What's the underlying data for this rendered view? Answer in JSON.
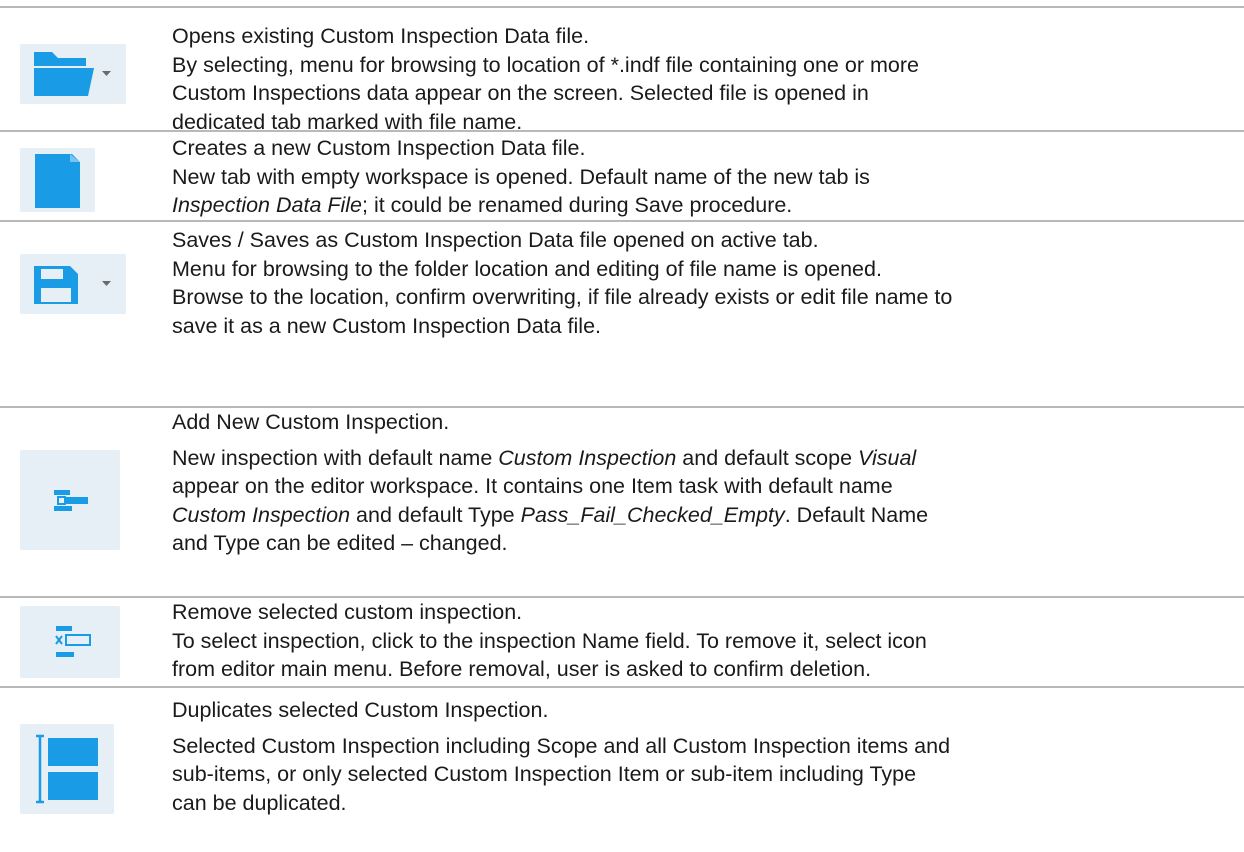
{
  "colors": {
    "icon_blue": "#1a9be6",
    "tile_bg": "#e6eef6",
    "rule": "#b9b9b9"
  },
  "rows": [
    {
      "icon": "folder-open-icon",
      "has_dropdown": true,
      "title": "Opens existing Custom Inspection Data file.",
      "lines": [
        "By selecting, menu for browsing to location of *.indf file containing one or more",
        "Custom Inspections data appear on the screen. Selected file is opened in",
        "dedicated tab marked with file name."
      ]
    },
    {
      "icon": "new-file-icon",
      "has_dropdown": false,
      "title": "Creates a new Custom Inspection Data file.",
      "line1": "New tab with empty workspace is opened. Default name of the new tab is",
      "line2_italic": "Inspection Data File",
      "line2_rest": "; it could be renamed during Save procedure."
    },
    {
      "icon": "save-icon",
      "has_dropdown": true,
      "title": "Saves / Saves as Custom Inspection Data file opened on active tab.",
      "lines": [
        "Menu for browsing to the folder location and editing of file name is opened.",
        "Browse to the location, confirm overwriting, if file already exists or edit file name to",
        "save it as a new Custom Inspection Data file."
      ]
    },
    {
      "icon": "add-inspection-icon",
      "has_dropdown": false,
      "title": "Add New Custom Inspection.",
      "l1a": "New inspection with default name ",
      "l1b": "Custom Inspection",
      "l1c": " and default scope ",
      "l1d": "Visual",
      "l2": "appear on the editor workspace. It contains one Item task with default name",
      "l3a": "Custom Inspection",
      "l3b": " and default Type ",
      "l3c": "Pass_Fail_Checked_Empty",
      "l3d": ". Default Name",
      "l4": "and Type can be edited – changed."
    },
    {
      "icon": "remove-inspection-icon",
      "has_dropdown": false,
      "title": "Remove selected custom inspection.",
      "lines": [
        "To select inspection, click to the inspection Name field. To remove it, select icon",
        "from editor main menu. Before removal, user is asked to confirm deletion."
      ]
    },
    {
      "icon": "duplicate-inspection-icon",
      "has_dropdown": false,
      "title": "Duplicates selected Custom Inspection.",
      "lines": [
        "Selected Custom Inspection including Scope and all Custom Inspection items and",
        "sub-items, or only selected Custom Inspection Item or sub-item including Type",
        "can be duplicated."
      ]
    }
  ]
}
